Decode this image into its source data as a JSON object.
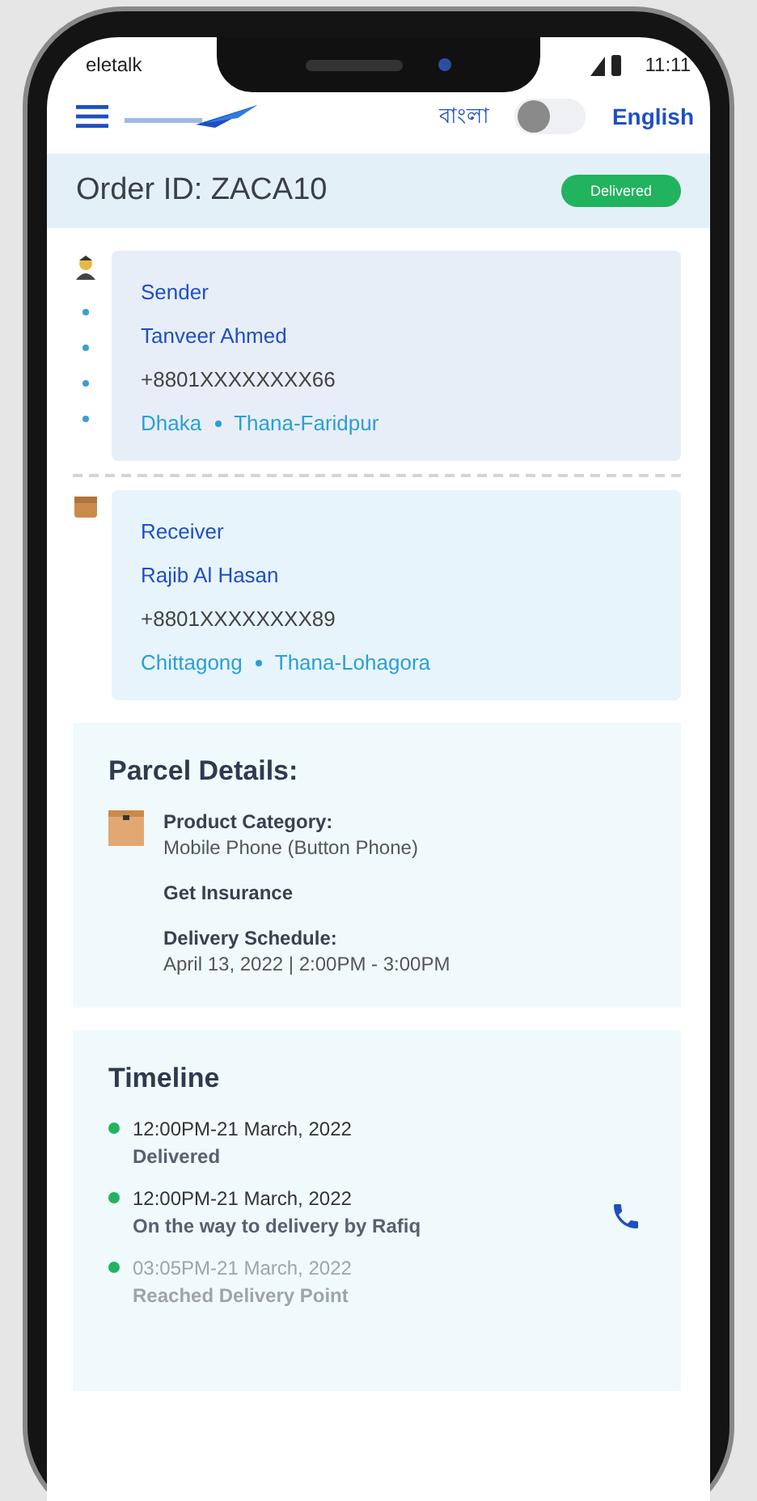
{
  "status_bar": {
    "carrier": "eletalk",
    "time": "11:11"
  },
  "header": {
    "language_left": "বাংলা",
    "toggle": {
      "on": false
    },
    "language_right": "English"
  },
  "order": {
    "title": "Order ID: ZACA10",
    "status": "Delivered"
  },
  "parties": [
    {
      "kind": "sender",
      "role": "Sender",
      "name": "Tanveer Ahmed",
      "phone": "+8801XXXXXXXX66",
      "city": "Dhaka",
      "area": "Thana-Faridpur"
    },
    {
      "kind": "receiver",
      "role": "Receiver",
      "name": "Rajib Al Hasan",
      "phone": "+8801XXXXXXXX89",
      "city": "Chittagong",
      "area": "Thana-Lohagora"
    }
  ],
  "parcel": {
    "title": "Parcel Details:",
    "category_label": "Product Category:",
    "category": "Mobile Phone (Button Phone)",
    "insurance": "Get Insurance",
    "schedule_label": "Delivery Schedule:",
    "schedule": "April 13, 2022 | 2:00PM - 3:00PM"
  },
  "timeline": {
    "title": "Timeline",
    "items": [
      {
        "time": "12:00PM-21 March, 2022",
        "status": "Delivered",
        "color": "#22b35e",
        "faded": false,
        "call": false
      },
      {
        "time": "12:00PM-21 March, 2022",
        "status": "On the way to delivery by Rafiq",
        "color": "#22b35e",
        "faded": false,
        "call": true
      },
      {
        "time": "03:05PM-21 March, 2022",
        "status": "Reached Delivery Point",
        "color": "#22b35e",
        "faded": true,
        "call": false
      }
    ]
  }
}
